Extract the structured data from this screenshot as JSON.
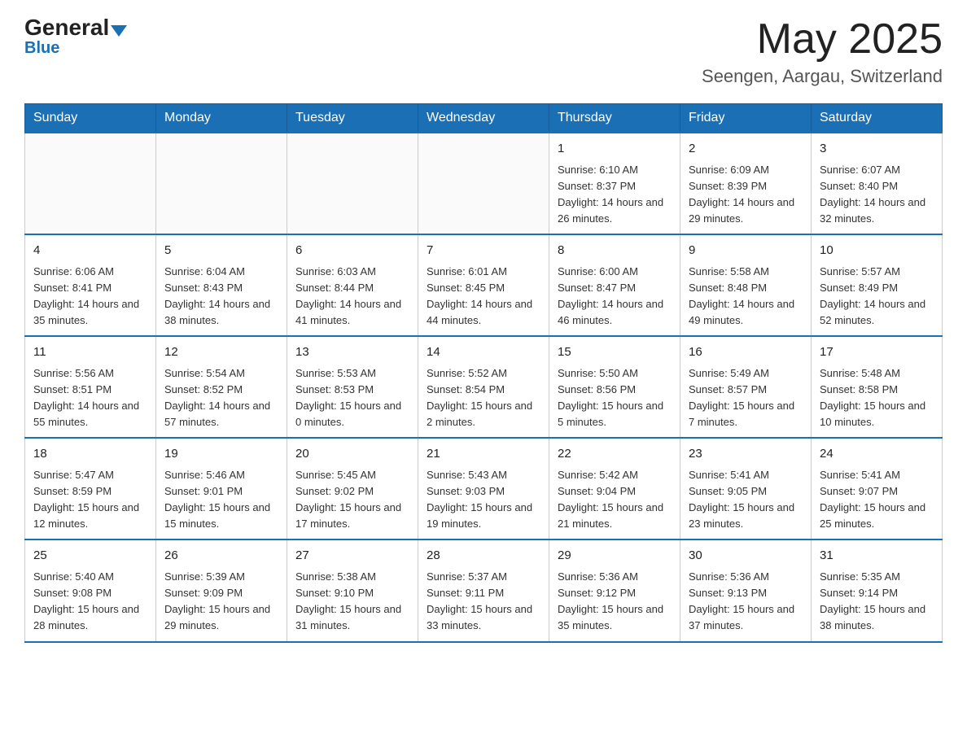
{
  "logo": {
    "general": "General",
    "blue": "Blue"
  },
  "header": {
    "month_year": "May 2025",
    "location": "Seengen, Aargau, Switzerland"
  },
  "weekdays": [
    "Sunday",
    "Monday",
    "Tuesday",
    "Wednesday",
    "Thursday",
    "Friday",
    "Saturday"
  ],
  "weeks": [
    [
      {
        "day": "",
        "info": ""
      },
      {
        "day": "",
        "info": ""
      },
      {
        "day": "",
        "info": ""
      },
      {
        "day": "",
        "info": ""
      },
      {
        "day": "1",
        "info": "Sunrise: 6:10 AM\nSunset: 8:37 PM\nDaylight: 14 hours and 26 minutes."
      },
      {
        "day": "2",
        "info": "Sunrise: 6:09 AM\nSunset: 8:39 PM\nDaylight: 14 hours and 29 minutes."
      },
      {
        "day": "3",
        "info": "Sunrise: 6:07 AM\nSunset: 8:40 PM\nDaylight: 14 hours and 32 minutes."
      }
    ],
    [
      {
        "day": "4",
        "info": "Sunrise: 6:06 AM\nSunset: 8:41 PM\nDaylight: 14 hours and 35 minutes."
      },
      {
        "day": "5",
        "info": "Sunrise: 6:04 AM\nSunset: 8:43 PM\nDaylight: 14 hours and 38 minutes."
      },
      {
        "day": "6",
        "info": "Sunrise: 6:03 AM\nSunset: 8:44 PM\nDaylight: 14 hours and 41 minutes."
      },
      {
        "day": "7",
        "info": "Sunrise: 6:01 AM\nSunset: 8:45 PM\nDaylight: 14 hours and 44 minutes."
      },
      {
        "day": "8",
        "info": "Sunrise: 6:00 AM\nSunset: 8:47 PM\nDaylight: 14 hours and 46 minutes."
      },
      {
        "day": "9",
        "info": "Sunrise: 5:58 AM\nSunset: 8:48 PM\nDaylight: 14 hours and 49 minutes."
      },
      {
        "day": "10",
        "info": "Sunrise: 5:57 AM\nSunset: 8:49 PM\nDaylight: 14 hours and 52 minutes."
      }
    ],
    [
      {
        "day": "11",
        "info": "Sunrise: 5:56 AM\nSunset: 8:51 PM\nDaylight: 14 hours and 55 minutes."
      },
      {
        "day": "12",
        "info": "Sunrise: 5:54 AM\nSunset: 8:52 PM\nDaylight: 14 hours and 57 minutes."
      },
      {
        "day": "13",
        "info": "Sunrise: 5:53 AM\nSunset: 8:53 PM\nDaylight: 15 hours and 0 minutes."
      },
      {
        "day": "14",
        "info": "Sunrise: 5:52 AM\nSunset: 8:54 PM\nDaylight: 15 hours and 2 minutes."
      },
      {
        "day": "15",
        "info": "Sunrise: 5:50 AM\nSunset: 8:56 PM\nDaylight: 15 hours and 5 minutes."
      },
      {
        "day": "16",
        "info": "Sunrise: 5:49 AM\nSunset: 8:57 PM\nDaylight: 15 hours and 7 minutes."
      },
      {
        "day": "17",
        "info": "Sunrise: 5:48 AM\nSunset: 8:58 PM\nDaylight: 15 hours and 10 minutes."
      }
    ],
    [
      {
        "day": "18",
        "info": "Sunrise: 5:47 AM\nSunset: 8:59 PM\nDaylight: 15 hours and 12 minutes."
      },
      {
        "day": "19",
        "info": "Sunrise: 5:46 AM\nSunset: 9:01 PM\nDaylight: 15 hours and 15 minutes."
      },
      {
        "day": "20",
        "info": "Sunrise: 5:45 AM\nSunset: 9:02 PM\nDaylight: 15 hours and 17 minutes."
      },
      {
        "day": "21",
        "info": "Sunrise: 5:43 AM\nSunset: 9:03 PM\nDaylight: 15 hours and 19 minutes."
      },
      {
        "day": "22",
        "info": "Sunrise: 5:42 AM\nSunset: 9:04 PM\nDaylight: 15 hours and 21 minutes."
      },
      {
        "day": "23",
        "info": "Sunrise: 5:41 AM\nSunset: 9:05 PM\nDaylight: 15 hours and 23 minutes."
      },
      {
        "day": "24",
        "info": "Sunrise: 5:41 AM\nSunset: 9:07 PM\nDaylight: 15 hours and 25 minutes."
      }
    ],
    [
      {
        "day": "25",
        "info": "Sunrise: 5:40 AM\nSunset: 9:08 PM\nDaylight: 15 hours and 28 minutes."
      },
      {
        "day": "26",
        "info": "Sunrise: 5:39 AM\nSunset: 9:09 PM\nDaylight: 15 hours and 29 minutes."
      },
      {
        "day": "27",
        "info": "Sunrise: 5:38 AM\nSunset: 9:10 PM\nDaylight: 15 hours and 31 minutes."
      },
      {
        "day": "28",
        "info": "Sunrise: 5:37 AM\nSunset: 9:11 PM\nDaylight: 15 hours and 33 minutes."
      },
      {
        "day": "29",
        "info": "Sunrise: 5:36 AM\nSunset: 9:12 PM\nDaylight: 15 hours and 35 minutes."
      },
      {
        "day": "30",
        "info": "Sunrise: 5:36 AM\nSunset: 9:13 PM\nDaylight: 15 hours and 37 minutes."
      },
      {
        "day": "31",
        "info": "Sunrise: 5:35 AM\nSunset: 9:14 PM\nDaylight: 15 hours and 38 minutes."
      }
    ]
  ]
}
